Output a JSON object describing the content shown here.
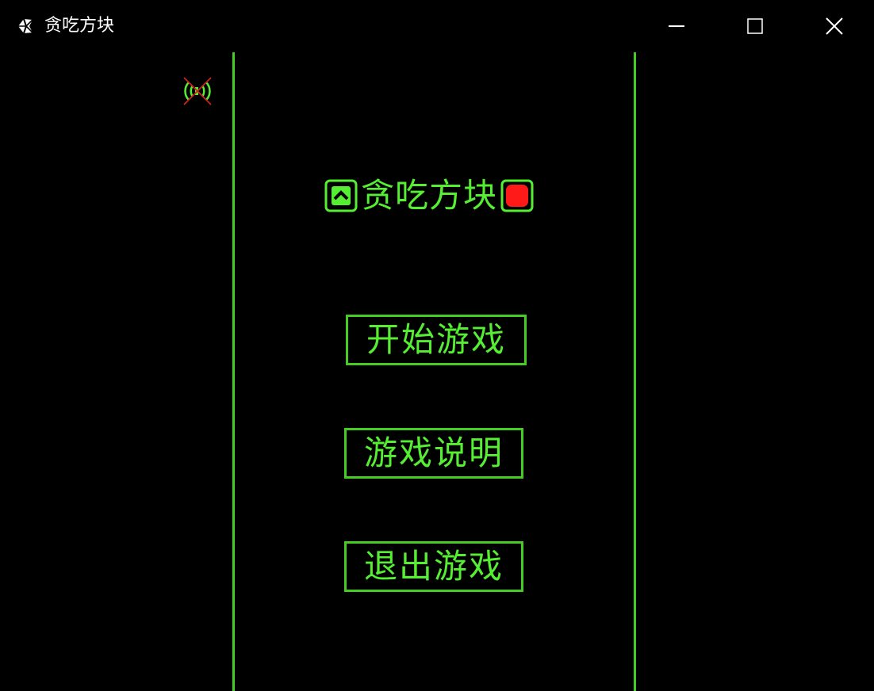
{
  "window": {
    "title": "贪吃方块",
    "icon": "unity-logo-icon",
    "controls": [
      "minimize-icon",
      "maximize-icon",
      "close-icon"
    ]
  },
  "game": {
    "title": "贪吃方块",
    "title_left_icon": "snake-head-up-icon",
    "title_right_icon": "food-block-icon",
    "sound_icon": "sound-muted-icon",
    "colors": {
      "background": "#000000",
      "border": "#44cc22",
      "text": "#55ee33",
      "food": "#ff1a1a",
      "mute_cross": "#cc2222"
    }
  },
  "menu": {
    "start_label": "开始游戏",
    "help_label": "游戏说明",
    "quit_label": "退出游戏"
  }
}
